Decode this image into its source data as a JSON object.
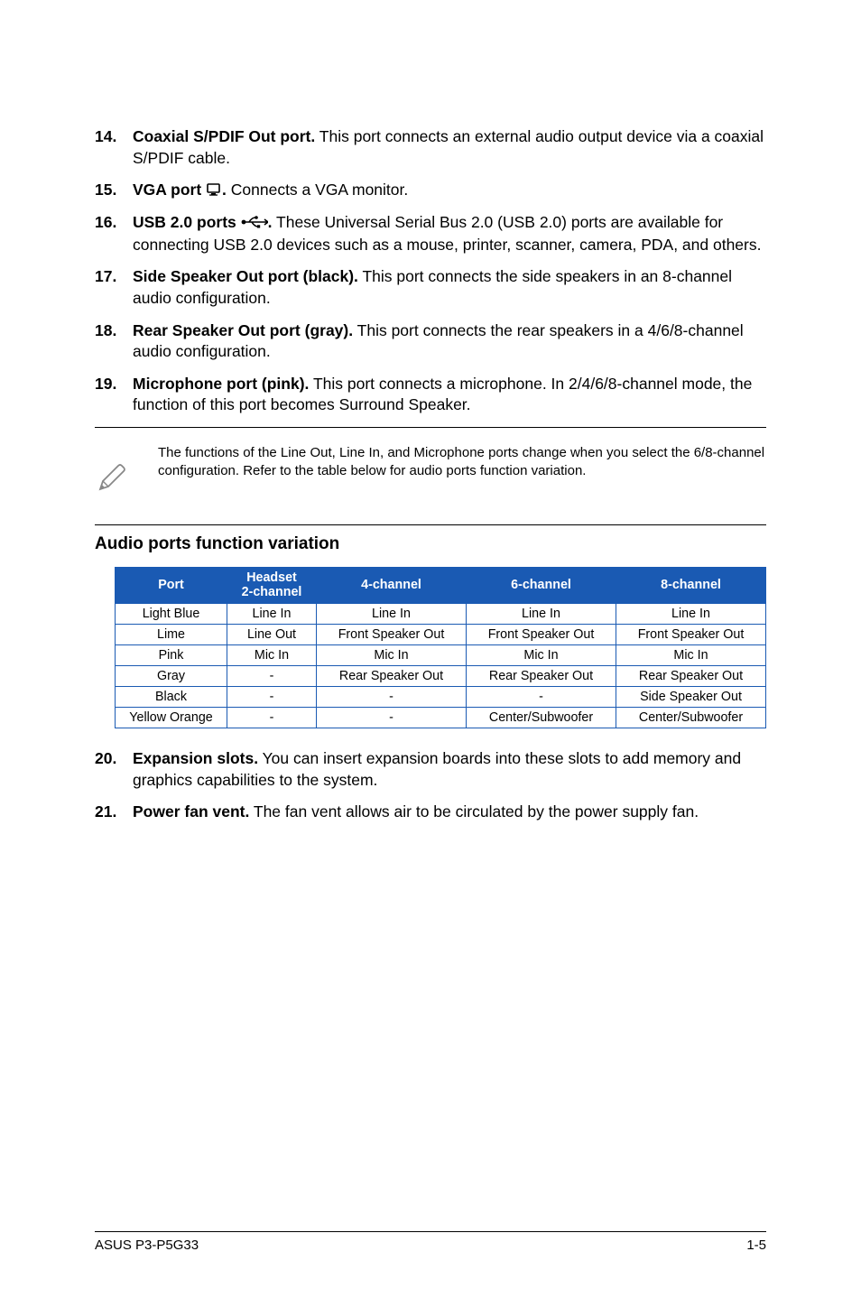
{
  "list": {
    "i14": {
      "num": "14.",
      "bold": "Coaxial S/PDIF Out port.",
      "text": " This port connects an external audio output device via a coaxial S/PDIF cable."
    },
    "i15": {
      "num": "15.",
      "bold_pre": "VGA port ",
      "bold_post": ".",
      "text": " Connects a VGA monitor."
    },
    "i16": {
      "num": "16.",
      "bold_pre": "USB 2.0 ports ",
      "bold_post": ".",
      "text": " These Universal Serial Bus 2.0 (USB 2.0) ports are available for connecting USB 2.0 devices such as a mouse, printer, scanner, camera, PDA, and others."
    },
    "i17": {
      "num": "17.",
      "bold": "Side Speaker Out port (black).",
      "text": " This port connects the side speakers in an 8-channel audio configuration."
    },
    "i18": {
      "num": "18.",
      "bold": "Rear Speaker Out port (gray).",
      "text": " This port connects the rear speakers in a 4/6/8-channel audio configuration."
    },
    "i19": {
      "num": "19.",
      "bold": "Microphone port (pink).",
      "text": " This port connects a microphone. In 2/4/6/8-channel mode, the function of this port becomes Surround Speaker."
    },
    "i20": {
      "num": "20.",
      "bold": "Expansion slots.",
      "text": " You can insert expansion boards into these slots to add memory and graphics capabilities to the system."
    },
    "i21": {
      "num": "21.",
      "bold": "Power fan vent.",
      "text": " The fan vent allows air to be circulated by the power supply fan."
    }
  },
  "note": "The functions of the Line Out, Line In, and Microphone ports change when you select the 6/8-channel configuration. Refer to the table below for audio ports function variation.",
  "section_title": "Audio ports function variation",
  "table": {
    "h1": "Port",
    "h2_l1": "Headset",
    "h2_l2": "2-channel",
    "h3": "4-channel",
    "h4": "6-channel",
    "h5": "8-channel",
    "rows": [
      {
        "c1": "Light Blue",
        "c2": "Line In",
        "c3": "Line In",
        "c4": "Line In",
        "c5": "Line In"
      },
      {
        "c1": "Lime",
        "c2": "Line Out",
        "c3": "Front Speaker Out",
        "c4": "Front Speaker Out",
        "c5": "Front Speaker Out"
      },
      {
        "c1": "Pink",
        "c2": "Mic In",
        "c3": "Mic In",
        "c4": "Mic In",
        "c5": "Mic In"
      },
      {
        "c1": "Gray",
        "c2": "-",
        "c3": "Rear Speaker Out",
        "c4": "Rear Speaker Out",
        "c5": "Rear Speaker Out"
      },
      {
        "c1": "Black",
        "c2": "-",
        "c3": "-",
        "c4": "-",
        "c5": "Side Speaker Out"
      },
      {
        "c1": "Yellow Orange",
        "c2": "-",
        "c3": "-",
        "c4": "Center/Subwoofer",
        "c5": "Center/Subwoofer"
      }
    ]
  },
  "footer": {
    "left": "ASUS P3-P5G33",
    "right": "1-5"
  }
}
